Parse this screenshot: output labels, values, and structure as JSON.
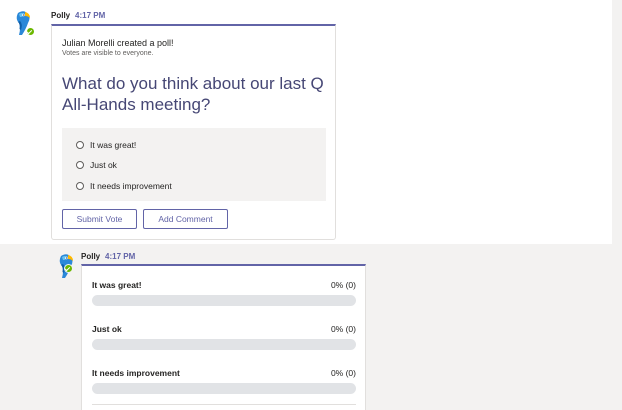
{
  "colors": {
    "accent": "#6264a7",
    "presence": "#6bb700",
    "background": "#f3f2f1",
    "question": "#464775"
  },
  "poll_message": {
    "sender": "Polly",
    "time": "4:17 PM",
    "avatar_icon": "parrot-icon",
    "creator_text": "Julian Morelli created a poll!",
    "visibility_text": "Votes are visible to everyone.",
    "question": "What do you think about our last Q All-Hands meeting?",
    "options": [
      {
        "label": "It was great!",
        "selected": false
      },
      {
        "label": "Just ok",
        "selected": false
      },
      {
        "label": "It needs improvement",
        "selected": false
      }
    ],
    "submit_label": "Submit Vote",
    "comment_label": "Add Comment"
  },
  "results_message": {
    "sender": "Polly",
    "time": "4:17 PM",
    "avatar_icon": "parrot-icon",
    "results": [
      {
        "label": "It was great!",
        "percent_text": "0% (0)",
        "percent": 0
      },
      {
        "label": "Just ok",
        "percent_text": "0% (0)",
        "percent": 0
      },
      {
        "label": "It needs improvement",
        "percent_text": "0% (0)",
        "percent": 0
      }
    ]
  }
}
